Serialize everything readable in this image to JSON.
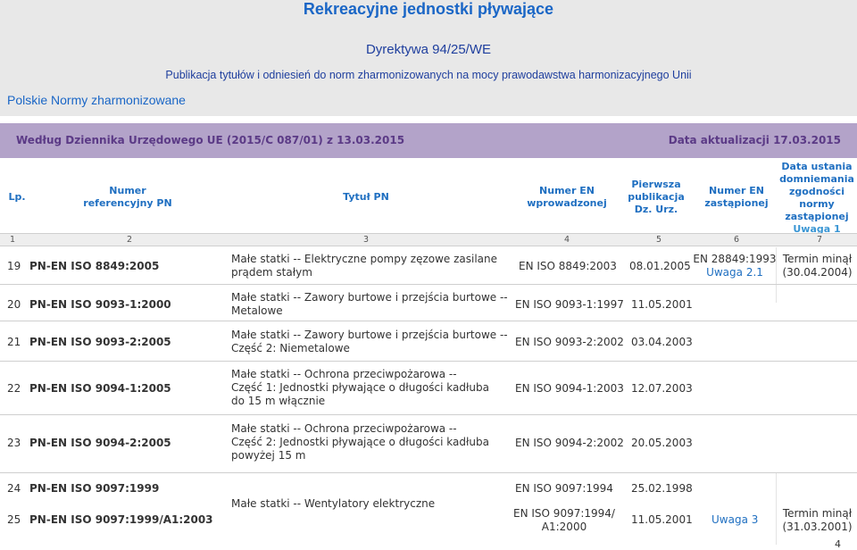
{
  "header": {
    "title": "Rekreacyjne jednostki pływające",
    "directive": "Dyrektywa 94/25/WE",
    "subtitle": "Publikacja tytułów i odniesień do norm zharmonizowanych na mocy prawodawstwa harmonizacyjnego Unii",
    "harmonized": "Polskie Normy zharmonizowane"
  },
  "journal": {
    "left": "Według Dziennika Urzędowego UE (2015/C 087/01) z 13.03.2015",
    "right": "Data aktualizacji 17.03.2015"
  },
  "table": {
    "columns": {
      "lp": "Lp.",
      "ref_1": "Numer",
      "ref_2": "referencyjny PN",
      "title": "Tytuł PN",
      "en_1": "Numer EN",
      "en_2": "wprowadzonej",
      "pub_1": "Pierwsza",
      "pub_2": "publikacja",
      "pub_3": "Dz. Urz.",
      "repl_1": "Numer EN",
      "repl_2": "zastąpionej",
      "date_1": "Data ustania",
      "date_2": "domniemania",
      "date_3": "zgodności",
      "date_4": "normy",
      "date_5": "zastąpionej",
      "date_6": "Uwaga 1"
    },
    "col_numbers": [
      "1",
      "2",
      "3",
      "4",
      "5",
      "6",
      "7"
    ],
    "rows": [
      {
        "lp": "19",
        "ref": "PN-EN ISO 8849:2005",
        "title_1": "Małe statki -- Elektryczne pompy zęzowe zasilane",
        "title_2": "prądem stałym",
        "title_3": "",
        "en": "EN ISO 8849:2003",
        "pub": "08.01.2005",
        "repl_1": "EN 28849:1993",
        "repl_2": "Uwaga 2.1",
        "date_1": "Termin minął",
        "date_2": "(30.04.2004)"
      },
      {
        "lp": "20",
        "ref": "PN-EN ISO 9093-1:2000",
        "title_1": "Małe statki -- Zawory burtowe i przejścia burtowe --",
        "title_2": "Metalowe",
        "title_3": "",
        "en": "EN ISO 9093-1:1997",
        "pub": "11.05.2001",
        "repl_1": "",
        "repl_2": "",
        "date_1": "",
        "date_2": ""
      },
      {
        "lp": "21",
        "ref": "PN-EN ISO 9093-2:2005",
        "title_1": "Małe statki -- Zawory burtowe i przejścia burtowe --",
        "title_2": "Część 2: Niemetalowe",
        "title_3": "",
        "en": "EN ISO 9093-2:2002",
        "pub": "03.04.2003",
        "repl_1": "",
        "repl_2": "",
        "date_1": "",
        "date_2": ""
      },
      {
        "lp": "22",
        "ref": "PN-EN ISO 9094-1:2005",
        "title_1": "Małe statki -- Ochrona przeciwpożarowa --",
        "title_2": "Część 1: Jednostki pływające o długości kadłuba",
        "title_3": "do 15 m włącznie",
        "en": "EN ISO 9094-1:2003",
        "pub": "12.07.2003",
        "repl_1": "",
        "repl_2": "",
        "date_1": "",
        "date_2": ""
      },
      {
        "lp": "23",
        "ref": "PN-EN ISO 9094-2:2005",
        "title_1": "Małe statki -- Ochrona przeciwpożarowa --",
        "title_2": "Część 2: Jednostki pływające o długości kadłuba",
        "title_3": "powyżej 15 m",
        "en": "EN ISO 9094-2:2002",
        "pub": "20.05.2003",
        "repl_1": "",
        "repl_2": "",
        "date_1": "",
        "date_2": ""
      }
    ],
    "shared_title": "Małe statki -- Wentylatory elektryczne",
    "row24": {
      "lp": "24",
      "ref": "PN-EN ISO 9097:1999",
      "en": "EN ISO 9097:1994",
      "pub": "25.02.1998"
    },
    "row25": {
      "lp": "25",
      "ref": "PN-EN ISO 9097:1999/A1:2003",
      "en_1": "EN ISO 9097:1994/",
      "en_2": "A1:2000",
      "pub": "11.05.2001",
      "repl": "Uwaga 3",
      "date_1": "Termin minął",
      "date_2": "(31.03.2001)"
    }
  },
  "page_number": "4"
}
